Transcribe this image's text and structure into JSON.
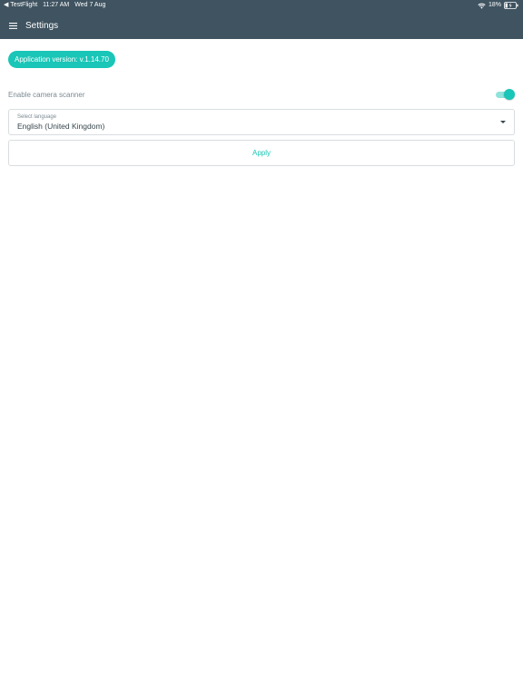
{
  "status_bar": {
    "back_app": "◀ TestFlight",
    "time": "11:27 AM",
    "date": "Wed 7 Aug",
    "battery_percent": "18%",
    "icons": [
      "wifi-icon",
      "battery-charging-icon"
    ]
  },
  "app_bar": {
    "title": "Settings",
    "menu_icon": "hamburger-menu-icon"
  },
  "version_chip": {
    "label": "Application version: v.1.14.70"
  },
  "camera_scanner": {
    "label": "Enable camera scanner",
    "enabled": true
  },
  "language_select": {
    "label": "Select language",
    "value": "English (United Kingdom)"
  },
  "apply_button": {
    "label": "Apply"
  },
  "colors": {
    "header": "#3f5360",
    "accent": "#19c6b7",
    "accent_light": "#8fe3da",
    "border": "#d8dde0"
  }
}
